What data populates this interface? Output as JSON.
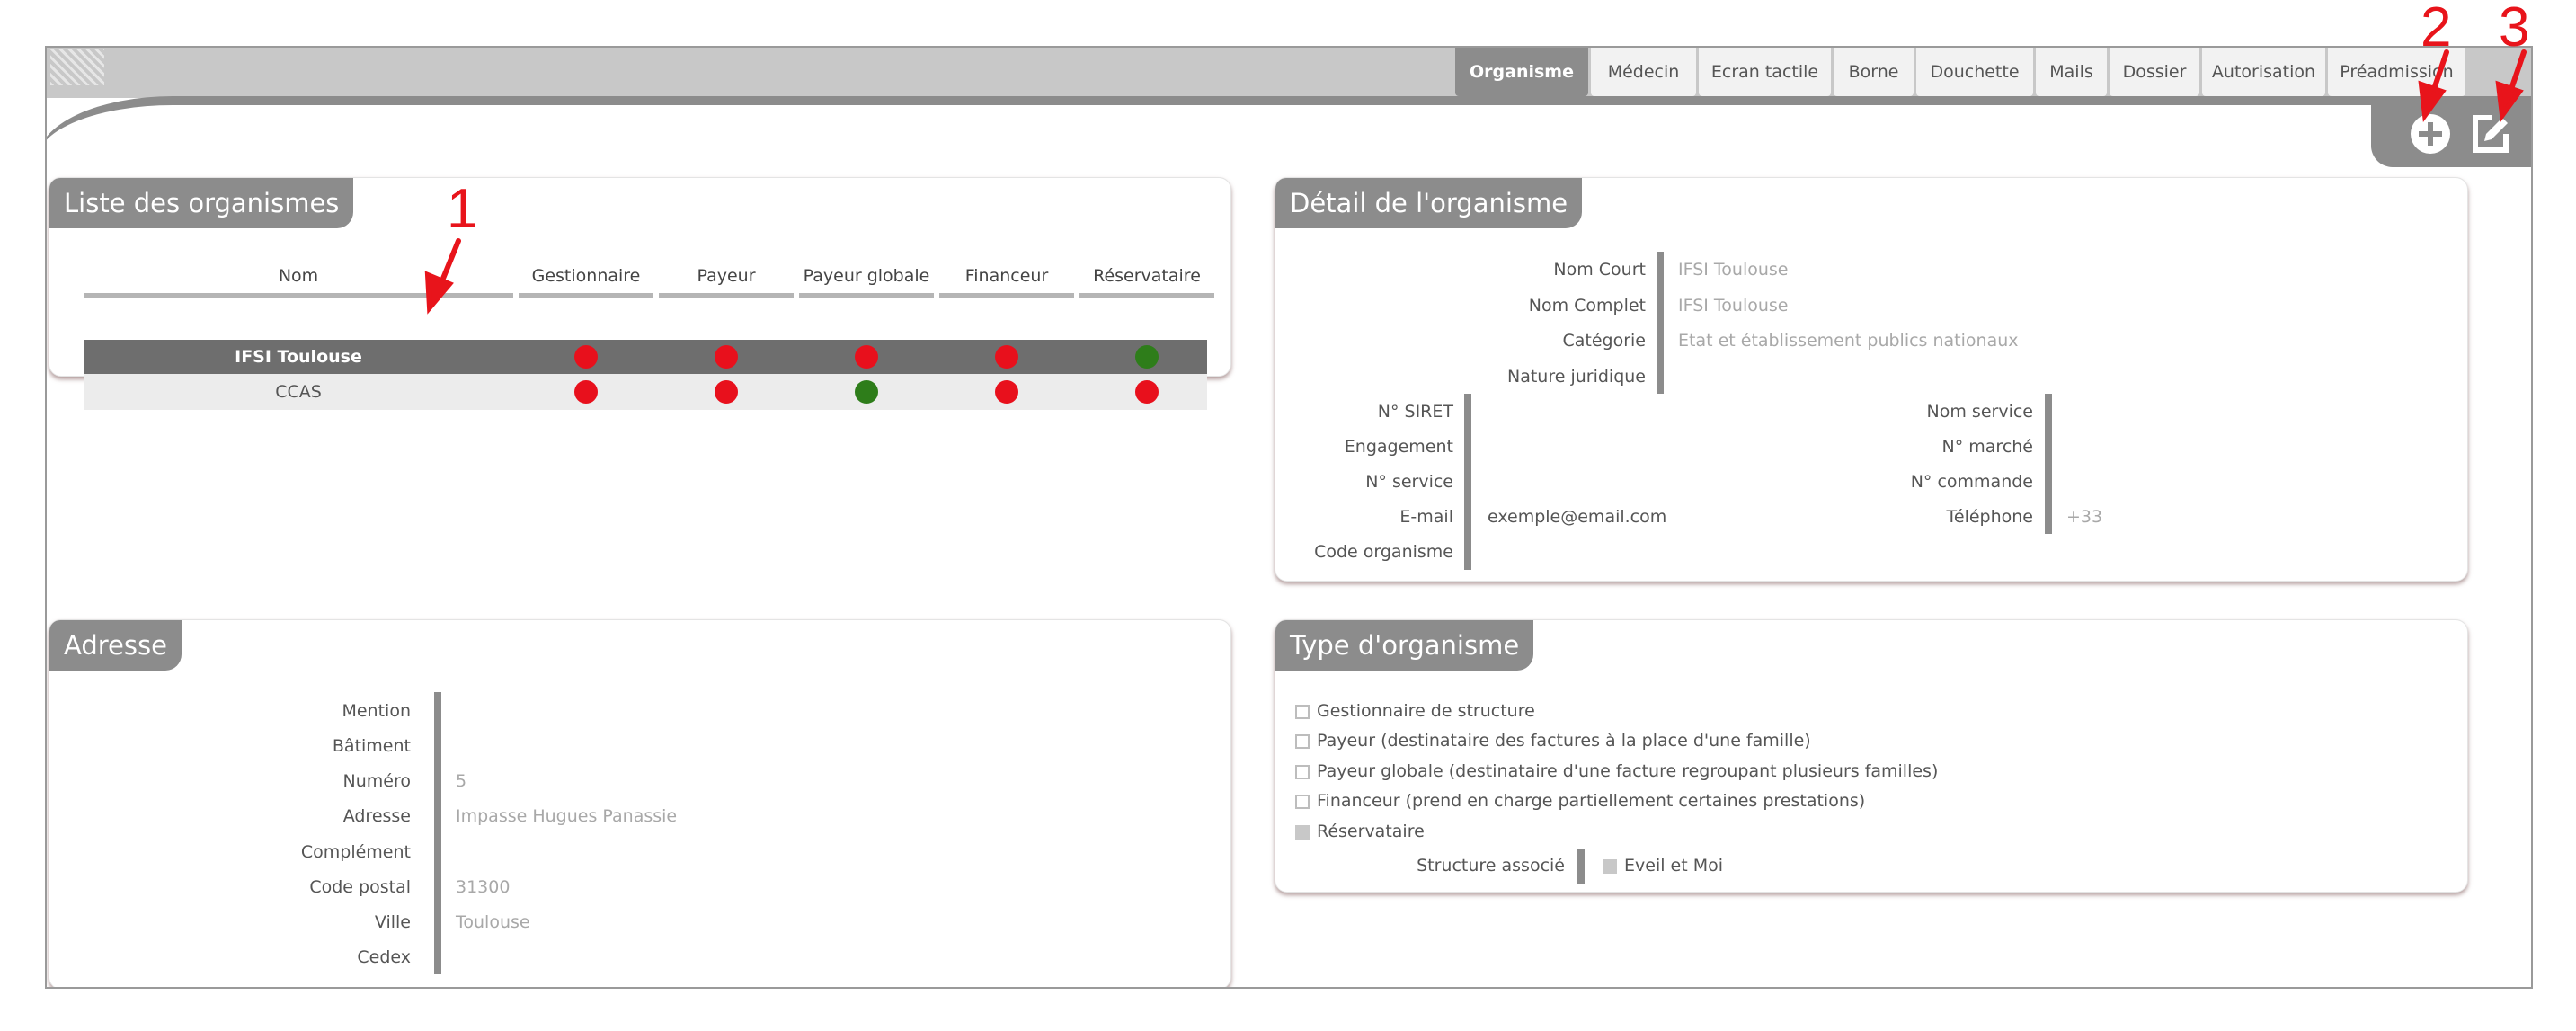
{
  "tabs": [
    {
      "label": "Organisme",
      "active": true
    },
    {
      "label": "Médecin"
    },
    {
      "label": "Ecran tactile"
    },
    {
      "label": "Borne"
    },
    {
      "label": "Douchette"
    },
    {
      "label": "Mails"
    },
    {
      "label": "Dossier"
    },
    {
      "label": "Autorisation"
    },
    {
      "label": "Préadmission"
    }
  ],
  "actions": {
    "add_icon": "plus-circle-icon",
    "edit_icon": "edit-icon"
  },
  "annotations": {
    "one": "1",
    "two": "2",
    "three": "3",
    "color": "#e8141b"
  },
  "liste": {
    "title": "Liste des organismes",
    "columns": [
      "Nom",
      "Gestionnaire",
      "Payeur",
      "Payeur globale",
      "Financeur",
      "Réservataire"
    ],
    "rows": [
      {
        "nom": "IFSI Toulouse",
        "selected": true,
        "flags": [
          "red",
          "red",
          "red",
          "red",
          "green"
        ]
      },
      {
        "nom": "CCAS",
        "selected": false,
        "flags": [
          "red",
          "red",
          "green",
          "red",
          "red"
        ]
      }
    ],
    "colors": {
      "red": "#e8101c",
      "green": "#2e7d1a"
    }
  },
  "detail": {
    "title": "Détail de l'organisme",
    "nom_court_label": "Nom Court",
    "nom_court": "IFSI Toulouse",
    "nom_complet_label": "Nom Complet",
    "nom_complet": "IFSI Toulouse",
    "categorie_label": "Catégorie",
    "categorie": "Etat et établissement publics nationaux",
    "nature_label": "Nature juridique",
    "siret_label": "N° SIRET",
    "engagement_label": "Engagement",
    "service_label": "N° service",
    "email_label": "E-mail",
    "email": "exemple@email.com",
    "code_label": "Code organisme",
    "nom_service_label": "Nom service",
    "marche_label": "N° marché",
    "commande_label": "N° commande",
    "telephone_label": "Téléphone",
    "telephone": "+33"
  },
  "adresse": {
    "title": "Adresse",
    "mention_label": "Mention",
    "batiment_label": "Bâtiment",
    "numero_label": "Numéro",
    "numero": "5",
    "adresse_label": "Adresse",
    "adresse": "Impasse Hugues Panassie",
    "complement_label": "Complément",
    "cp_label": "Code postal",
    "cp": "31300",
    "ville_label": "Ville",
    "ville": "Toulouse",
    "cedex_label": "Cedex"
  },
  "type": {
    "title": "Type d'organisme",
    "options": [
      {
        "label": "Gestionnaire de structure",
        "checked": false
      },
      {
        "label": "Payeur (destinataire des factures à la place d'une famille)",
        "checked": false
      },
      {
        "label": "Payeur globale (destinataire d'une facture regroupant plusieurs familles)",
        "checked": false
      },
      {
        "label": "Financeur (prend en charge partiellement certaines prestations)",
        "checked": false
      },
      {
        "label": "Réservataire",
        "checked": false,
        "disabled": true
      }
    ],
    "structure_label": "Structure associé",
    "structure_value": "Eveil et Moi"
  }
}
